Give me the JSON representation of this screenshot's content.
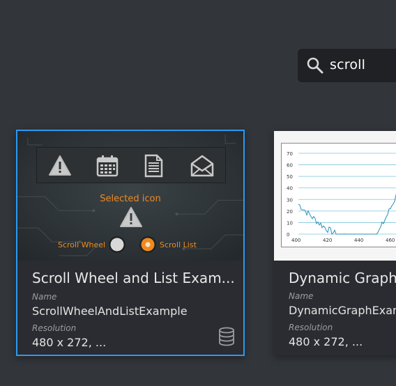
{
  "search": {
    "value": "scroll"
  },
  "cards": [
    {
      "title": "Scroll Wheel and List Exam...",
      "name_label": "Name",
      "name": "ScrollWheelAndListExample",
      "resolution_label": "Resolution",
      "resolution": "480 x 272, ...",
      "thumbnail": {
        "selected_label": "Selected icon",
        "scroll_wheel_label": "Scroll Wheel",
        "scroll_list_label": "Scroll List"
      }
    },
    {
      "title": "Dynamic Graph",
      "name_label": "Name",
      "name": "DynamicGraphExam",
      "resolution_label": "Resolution",
      "resolution": "480 x 272, ...",
      "thumbnail": {
        "y_ticks": [
          "70",
          "60",
          "50",
          "40",
          "30",
          "20",
          "10",
          "0"
        ],
        "x_ticks": [
          "400",
          "420",
          "440",
          "460"
        ]
      }
    }
  ],
  "colors": {
    "selected_border": "#2b9af3",
    "accent_orange": "#f08a1c",
    "background": "#32353a"
  }
}
